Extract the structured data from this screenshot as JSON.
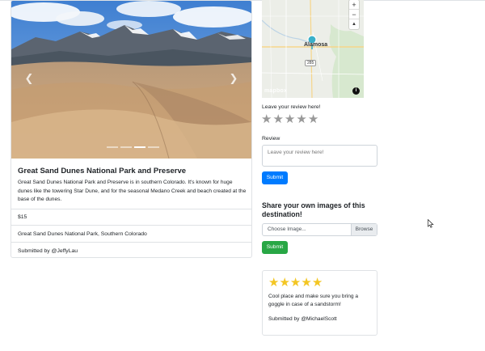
{
  "campground": {
    "title": "Great Sand Dunes National Park and Preserve",
    "description": "Great Sand Dunes National Park and Preserve is in southern Colorado. It's known for huge dunes like the towering Star Dune, and for the seasonal Medano Creek and beach created at the base of the dunes.",
    "price": "$15",
    "location": "Great Sand Dunes National Park, Southern Colorado",
    "submitted_by": "Submitted by @JeffyLau"
  },
  "carousel": {
    "prev_icon": "chevron-left-icon",
    "next_icon": "chevron-right-icon",
    "indicator_count": 4,
    "active_index": 2
  },
  "map": {
    "city_label": "Alamosa",
    "road_label": "285",
    "zoom_in": "+",
    "zoom_out": "−",
    "compass": "▲",
    "logo_text": "mapbox",
    "info_icon": "i"
  },
  "review_form": {
    "rating_label": "Leave your review here!",
    "rating_max": 5,
    "review_label": "Review",
    "review_placeholder": "Leave your review here!",
    "submit_label": "Submit"
  },
  "upload": {
    "title": "Share your own images of this destination!",
    "file_placeholder": "Choose Image...",
    "browse_label": "Browse",
    "submit_label": "Submit"
  },
  "reviews": [
    {
      "rating": 5,
      "text": "Cool place and make sure you bring a goggle in case of a sandstorm!",
      "author": "Submitted by @MichaelScott"
    }
  ],
  "colors": {
    "primary": "#007bff",
    "success": "#28a745",
    "star_filled": "#f3c623",
    "star_empty": "#999999"
  }
}
